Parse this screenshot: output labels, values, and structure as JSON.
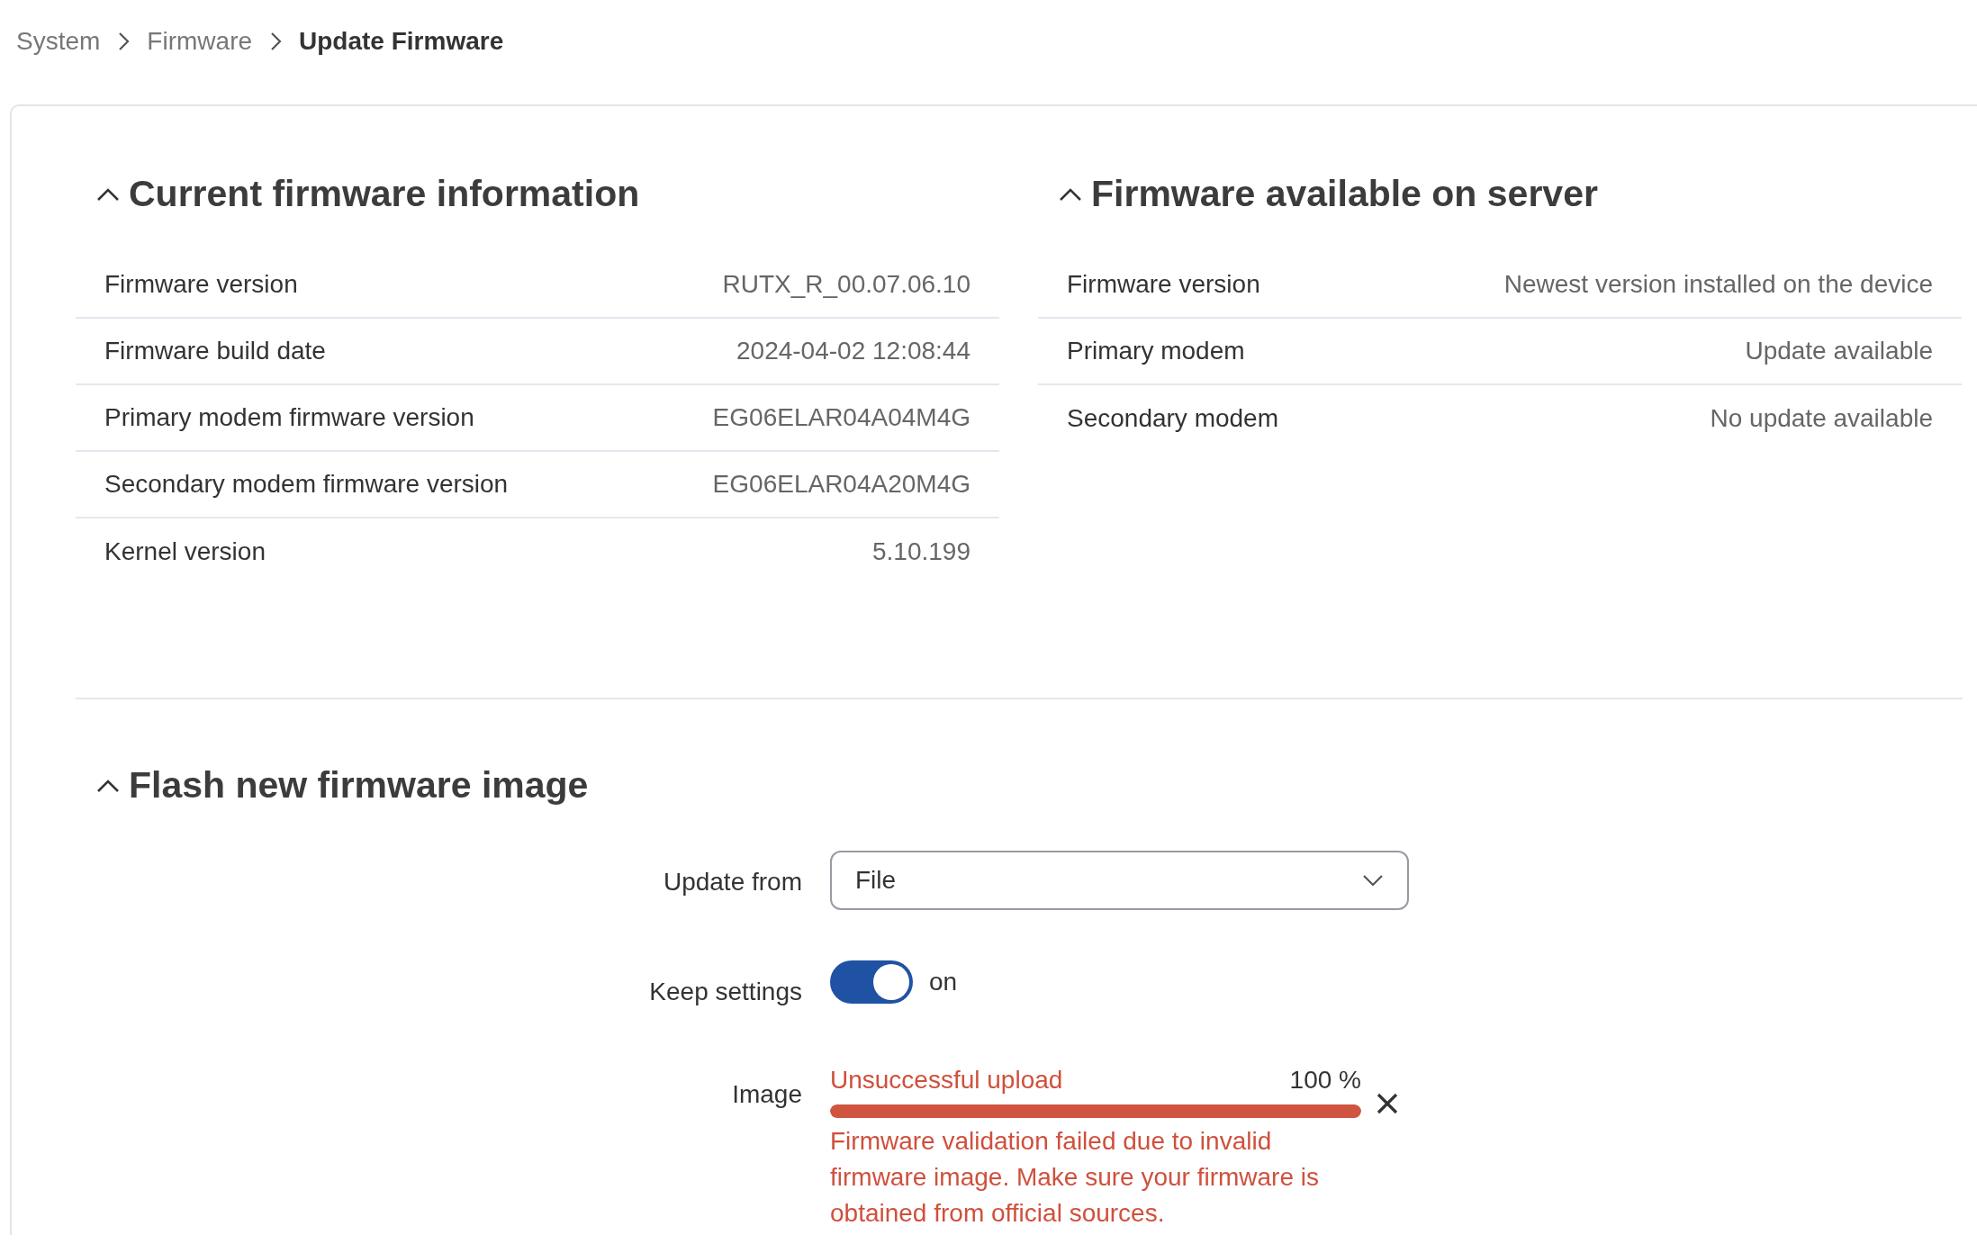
{
  "breadcrumb": [
    {
      "label": "System",
      "current": false
    },
    {
      "label": "Firmware",
      "current": false
    },
    {
      "label": "Update Firmware",
      "current": true
    }
  ],
  "sections": [
    {
      "title": "Current firmware information",
      "expanded": true,
      "rows": [
        {
          "label": "Firmware version",
          "value": "RUTX_R_00.07.06.10"
        },
        {
          "label": "Firmware build date",
          "value": "2024-04-02 12:08:44"
        },
        {
          "label": "Primary modem firmware version",
          "value": "EG06ELAR04A04M4G"
        },
        {
          "label": "Secondary modem firmware version",
          "value": "EG06ELAR04A20M4G"
        },
        {
          "label": "Kernel version",
          "value": "5.10.199"
        }
      ]
    },
    {
      "title": "Firmware available on server",
      "expanded": true,
      "rows": [
        {
          "label": "Firmware version",
          "value": "Newest version installed on the device"
        },
        {
          "label": "Primary modem",
          "value": "Update available"
        },
        {
          "label": "Secondary modem",
          "value": "No update available"
        }
      ]
    }
  ],
  "flash": {
    "title": "Flash new firmware image",
    "expanded": true,
    "fields": [
      {
        "kind": "select",
        "label": "Update from",
        "value": "File"
      },
      {
        "kind": "toggle",
        "label": "Keep settings",
        "on": true,
        "state_text": "on"
      },
      {
        "kind": "upload",
        "label": "Image",
        "status": "Unsuccessful upload",
        "percent": "100 %",
        "level": 1,
        "error": "Firmware validation failed due to invalid firmware image. Make sure your firmware is obtained from official sources."
      }
    ]
  }
}
